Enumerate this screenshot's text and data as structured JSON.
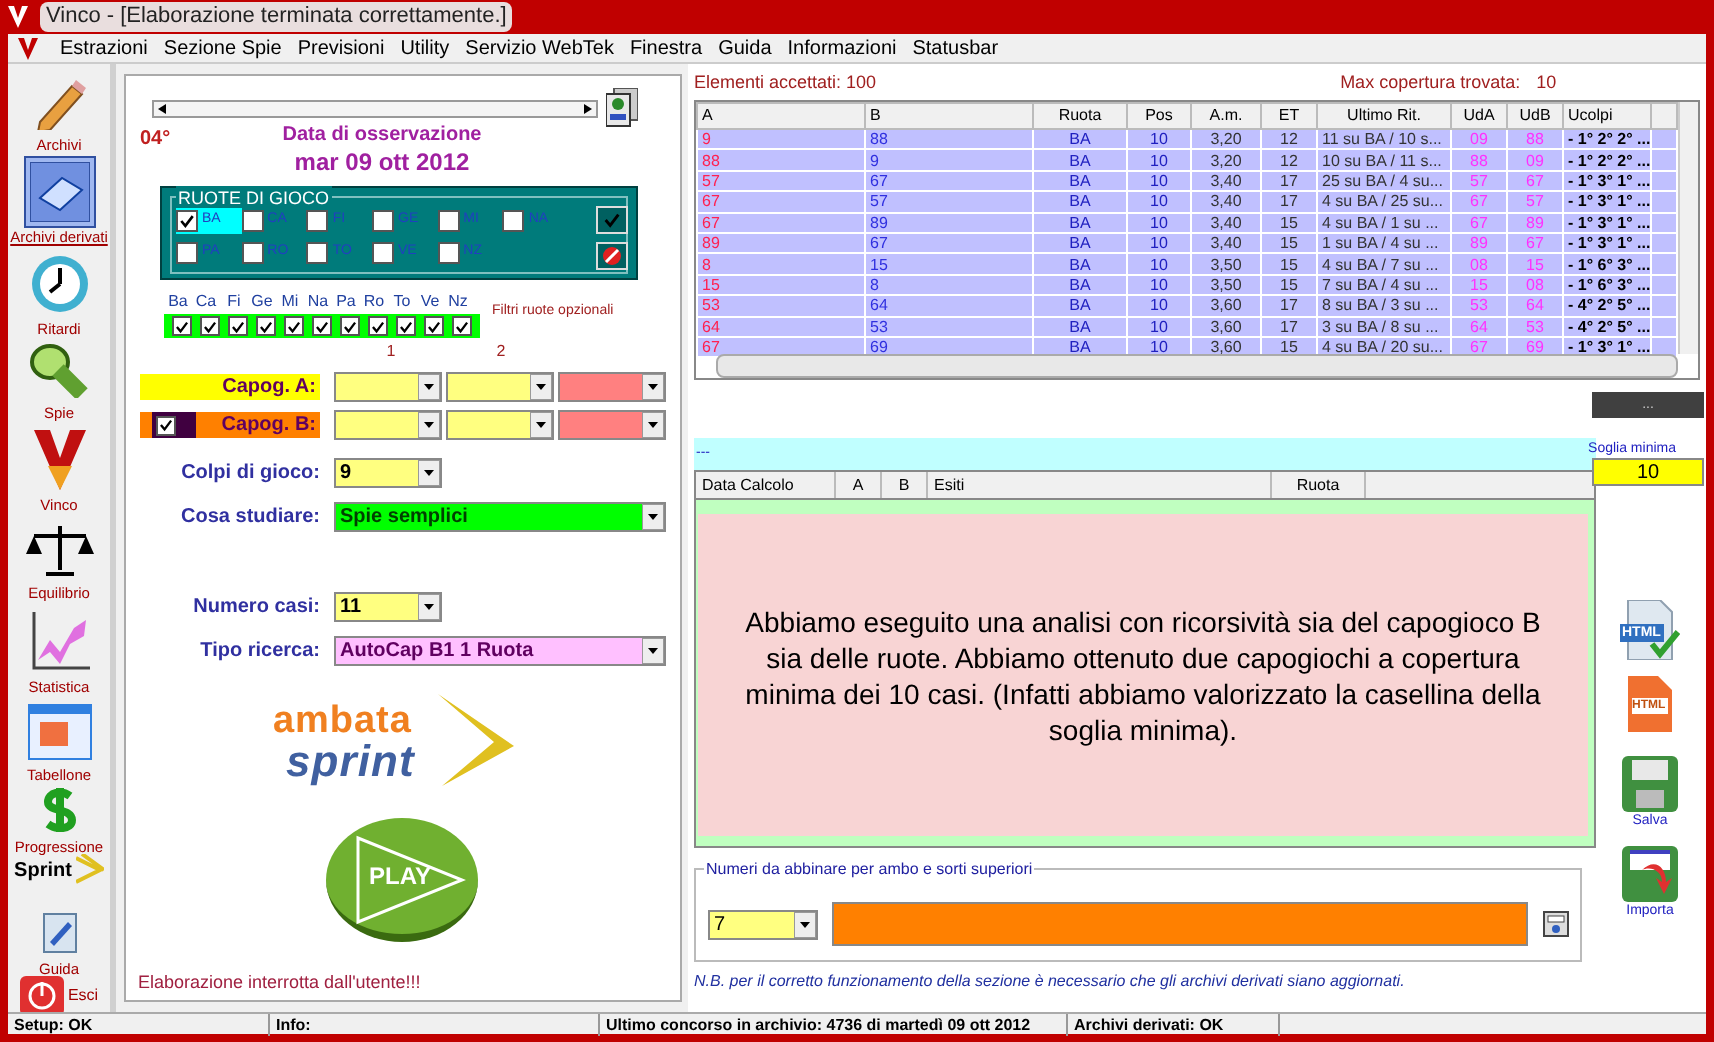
{
  "window": {
    "title": "Vinco - [Elaborazione terminata correttamente.]"
  },
  "menu": [
    "Estrazioni",
    "Sezione Spie",
    "Previsioni",
    "Utility",
    "Servizio WebTek",
    "Finestra",
    "Guida",
    "Informazioni",
    "Statusbar"
  ],
  "sidebar": [
    {
      "label": "Archivi",
      "kind": "pencil",
      "selected": false
    },
    {
      "label": "Archivi derivati",
      "kind": "book",
      "selected": true
    },
    {
      "label": "Ritardi",
      "kind": "clock",
      "selected": false
    },
    {
      "label": "Spie",
      "kind": "lamp",
      "selected": false
    },
    {
      "label": "Vinco",
      "kind": "vlogo",
      "selected": false
    },
    {
      "label": "Equilibrio",
      "kind": "scale",
      "selected": false
    },
    {
      "label": "Statistica",
      "kind": "chart",
      "selected": false
    },
    {
      "label": "Tabellone",
      "kind": "calendar",
      "selected": false
    },
    {
      "label": "Progressione",
      "kind": "dollar",
      "selected": false
    },
    {
      "label": "Sprint",
      "kind": "sprint",
      "selected": false
    },
    {
      "label": "Guida",
      "kind": "guide",
      "selected": false
    },
    {
      "label": "Esci",
      "kind": "power",
      "selected": false
    }
  ],
  "left": {
    "degree": "04°",
    "date_caption": "Data di osservazione",
    "date": "mar 09 ott 2012",
    "ruote": {
      "title": "RUOTE DI GIOCO",
      "wheels": [
        {
          "label": "BA",
          "checked": true
        },
        {
          "label": "CA",
          "checked": false
        },
        {
          "label": "FI",
          "checked": false
        },
        {
          "label": "GE",
          "checked": false
        },
        {
          "label": "MI",
          "checked": false
        },
        {
          "label": "NA",
          "checked": false
        },
        {
          "label": "PA",
          "checked": false
        },
        {
          "label": "RO",
          "checked": false
        },
        {
          "label": "TO",
          "checked": false
        },
        {
          "label": "VE",
          "checked": false
        },
        {
          "label": "NZ",
          "checked": false
        }
      ]
    },
    "filters": [
      {
        "label": "Ba",
        "checked": true
      },
      {
        "label": "Ca",
        "checked": true
      },
      {
        "label": "Fi",
        "checked": true
      },
      {
        "label": "Ge",
        "checked": true
      },
      {
        "label": "Mi",
        "checked": true
      },
      {
        "label": "Na",
        "checked": true
      },
      {
        "label": "Pa",
        "checked": true
      },
      {
        "label": "Ro",
        "checked": true
      },
      {
        "label": "To",
        "checked": true
      },
      {
        "label": "Ve",
        "checked": true
      },
      {
        "label": "Nz",
        "checked": true
      }
    ],
    "filters_note": "Filtri ruote opzionali",
    "column_labels": [
      "1",
      "2"
    ],
    "capogiochi": [
      {
        "label": "Capog. A:",
        "kind": "plain"
      },
      {
        "label": "Capog. B:",
        "kind": "checkbox",
        "checked": true
      }
    ],
    "colpi": {
      "label": "Colpi di gioco:",
      "value": "9"
    },
    "cosa": {
      "label": "Cosa studiare:",
      "value": "Spie semplici"
    },
    "numero_casi": {
      "label": "Numero casi:",
      "value": "11"
    },
    "tipo_ricerca": {
      "label": "Tipo ricerca:",
      "value": "AutoCap B1 1 Ruota"
    },
    "logo": [
      "ambata",
      "sprint"
    ],
    "play": "PLAY",
    "message": "Elaborazione interrotta dall'utente!!!"
  },
  "results": {
    "accepted": "Elementi accettati: 100",
    "max_label": "Max copertura trovata:",
    "max_value": "10",
    "columns": [
      "A",
      "B",
      "Ruota",
      "Pos",
      "A.m.",
      "ET",
      "Ultimo Rit.",
      "UdA",
      "UdB",
      "Ucolpi"
    ],
    "rows": [
      [
        "9",
        "88",
        "BA",
        "10",
        "3,20",
        "12",
        "11 su BA / 10 s...",
        "09",
        "88",
        "- 1° 2° 2° ..."
      ],
      [
        "88",
        "9",
        "BA",
        "10",
        "3,20",
        "12",
        "10 su BA / 11 s...",
        "88",
        "09",
        "- 1° 2° 2° ..."
      ],
      [
        "57",
        "67",
        "BA",
        "10",
        "3,40",
        "17",
        "25 su BA / 4 su...",
        "57",
        "67",
        "- 1° 3° 1° ..."
      ],
      [
        "67",
        "57",
        "BA",
        "10",
        "3,40",
        "17",
        "4 su BA / 25 su...",
        "67",
        "57",
        "- 1° 3° 1° ..."
      ],
      [
        "67",
        "89",
        "BA",
        "10",
        "3,40",
        "15",
        "4 su BA / 1 su ...",
        "67",
        "89",
        "- 1° 3° 1° ..."
      ],
      [
        "89",
        "67",
        "BA",
        "10",
        "3,40",
        "15",
        "1 su BA / 4 su ...",
        "89",
        "67",
        "- 1° 3° 1° ..."
      ],
      [
        "8",
        "15",
        "BA",
        "10",
        "3,50",
        "15",
        "4 su BA / 7 su ...",
        "08",
        "15",
        "- 1° 6° 3° ..."
      ],
      [
        "15",
        "8",
        "BA",
        "10",
        "3,50",
        "15",
        "7 su BA / 4 su ...",
        "15",
        "08",
        "- 1° 6° 3° ..."
      ],
      [
        "53",
        "64",
        "BA",
        "10",
        "3,60",
        "17",
        "8 su BA / 3 su ...",
        "53",
        "64",
        "- 4° 2° 5° ..."
      ],
      [
        "64",
        "53",
        "BA",
        "10",
        "3,60",
        "17",
        "3 su BA / 8 su ...",
        "64",
        "53",
        "- 4° 2° 5° ..."
      ],
      [
        "67",
        "69",
        "BA",
        "10",
        "3,60",
        "15",
        "4 su BA / 20 su...",
        "67",
        "69",
        "- 1° 3° 1° ..."
      ]
    ]
  },
  "dots_button": "...",
  "soglia": {
    "label": "Soglia minima",
    "value": "10"
  },
  "calc": {
    "bar_text": "---",
    "columns": [
      "Data Calcolo",
      "A",
      "B",
      "Esiti",
      "Ruota"
    ],
    "overlay": "Abbiamo eseguito una analisi con ricorsività sia del capogioco B sia delle ruote. Abbiamo ottenuto due capogiochi a copertura minima dei 10 casi. (Infatti abbiamo valorizzato la casellina della soglia minima)."
  },
  "right_tools": [
    {
      "label": "HTML",
      "kind": "html"
    },
    {
      "label": "HTML",
      "kind": "htmlfile"
    },
    {
      "label": "Salva",
      "kind": "save"
    },
    {
      "label": "Importa",
      "kind": "import"
    }
  ],
  "abbinare": {
    "title": "Numeri da abbinare per ambo e sorti superiori",
    "value": "7"
  },
  "note": "N.B. per il corretto funzionamento della sezione è necessario che gli archivi derivati siano aggiornati.",
  "status_bar": [
    "Setup: OK",
    "Info:",
    "Ultimo concorso in archivio: 4736 di martedì 09 ott 2012",
    "Archivi derivati: OK"
  ]
}
